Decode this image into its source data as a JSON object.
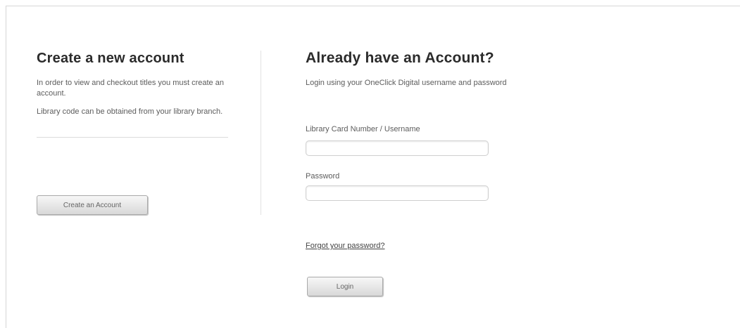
{
  "create_account": {
    "heading": "Create a new account",
    "description_1": "In order to view and checkout titles you must create an account.",
    "description_2": "Library code can be obtained from your library branch.",
    "button_label": "Create an Account"
  },
  "login": {
    "heading": "Already have an Account?",
    "description": "Login using your OneClick Digital username and password",
    "username_label": "Library Card Number / Username",
    "username_value": "",
    "password_label": "Password",
    "password_value": "",
    "forgot_link": "Forgot your password?",
    "button_label": "Login"
  }
}
